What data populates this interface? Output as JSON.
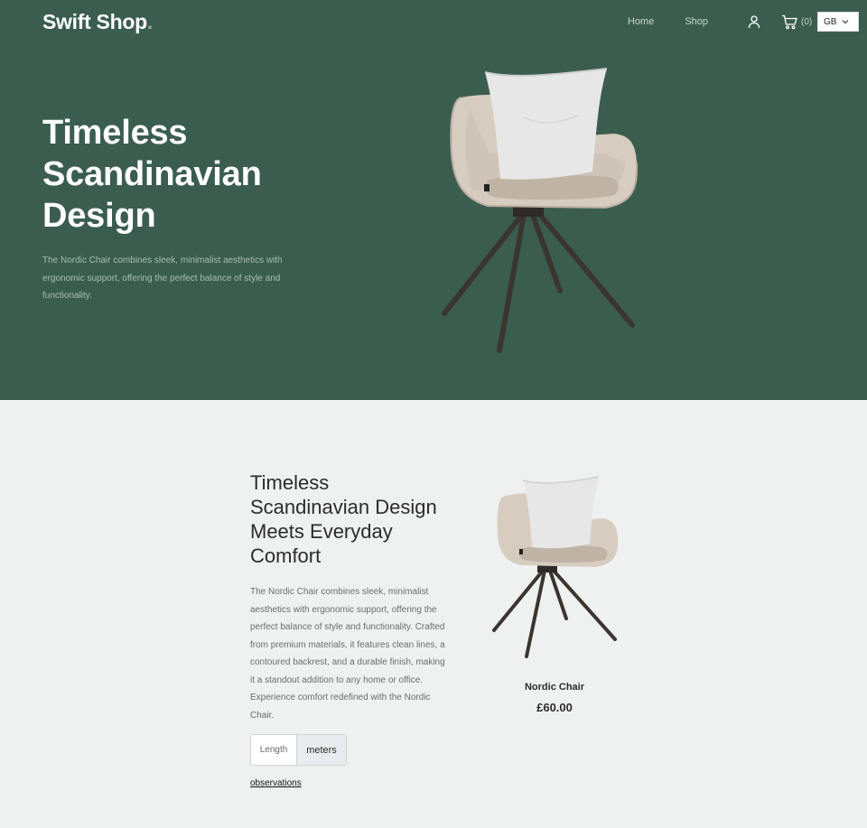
{
  "header": {
    "brand": "Swift Shop",
    "brand_dot": ".",
    "nav": [
      {
        "label": "Home"
      },
      {
        "label": "Shop"
      }
    ],
    "cart_count": "(0)",
    "locale": "GB",
    "icons": {
      "user": "user-icon",
      "cart": "cart-icon",
      "locale_caret": "chevron-down-icon"
    }
  },
  "hero": {
    "title": "Timeless Scandinavian Design",
    "description": "The Nordic Chair combines sleek, minimalist aesthetics with ergonomic support, offering the perfect balance of style and functionality."
  },
  "product": {
    "title": "Timeless Scandinavian Design Meets Everyday Comfort",
    "description": "The Nordic Chair combines sleek, minimalist aesthetics with ergonomic support, offering the perfect balance of style and functionality. Crafted from premium materials, it features clean lines, a contoured backrest, and a durable finish, making it a standout addition to any home or office. Experience comfort redefined with the Nordic Chair.",
    "unit_label": "Length",
    "unit_value": "meters",
    "observations_link": "observations",
    "card_name": "Nordic Chair",
    "card_price": "£60.00"
  },
  "colors": {
    "hero_bg": "#3b5d50",
    "page_bg": "#eff1f0",
    "text_dark": "#2b2b2b"
  }
}
